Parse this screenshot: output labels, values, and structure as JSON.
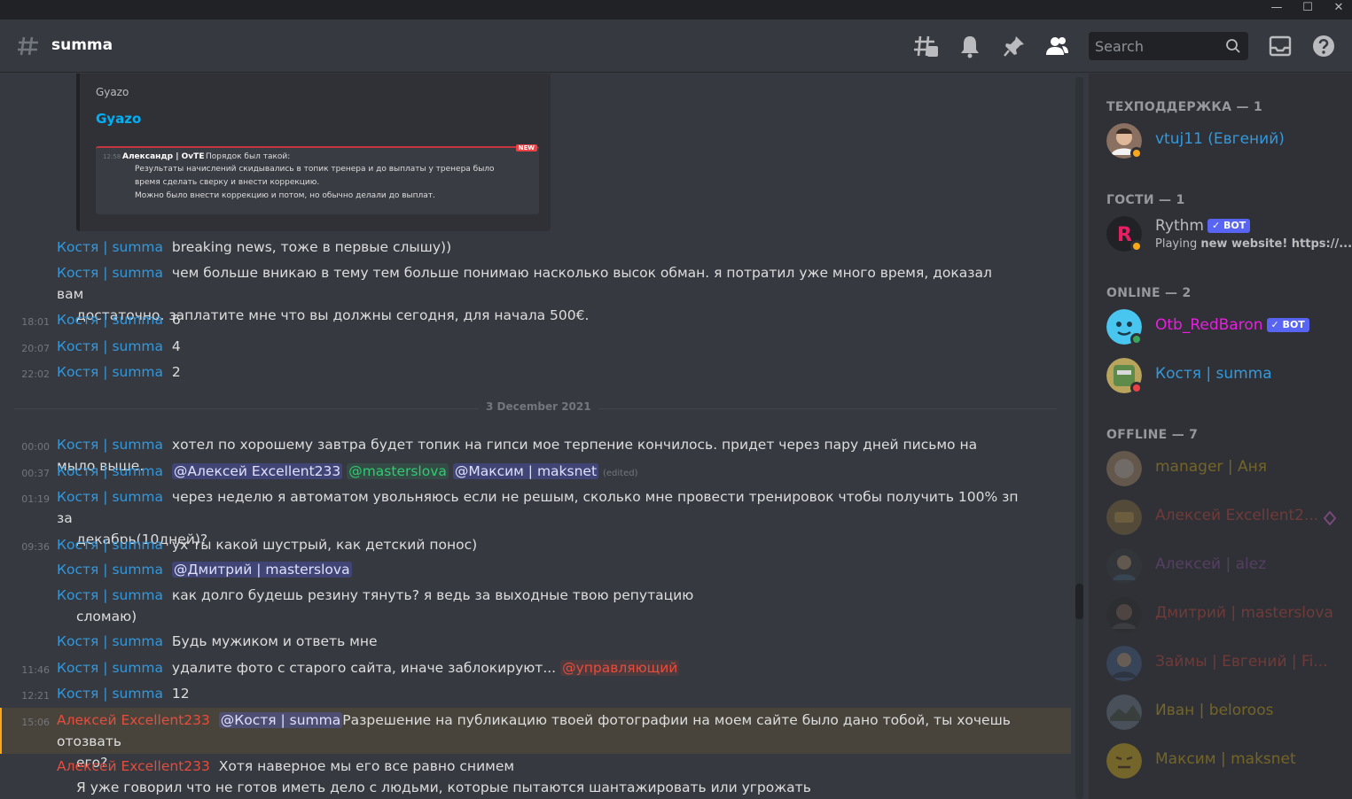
{
  "window": {
    "minimize": "—",
    "maximize": "☐",
    "close": "✕"
  },
  "header": {
    "channel": "summa",
    "search_placeholder": "Search"
  },
  "embed": {
    "provider": "Gyazo",
    "title": "Gyazo",
    "image": {
      "time": "12:58",
      "author": "Александр | OvTE",
      "first": "Порядок был такой:",
      "lines": [
        "Результаты начислений скидывались в топик тренера и до выплаты у тренера было",
        "время сделать сверку и внести коррекцию.",
        "Можно было внести коррекцию и потом, но обычно делали до выплат."
      ],
      "badge": "NEW"
    }
  },
  "messages": [
    {
      "time": "",
      "author": "Костя | summa",
      "text": "breaking news, тоже в первые слышу))"
    },
    {
      "time": "",
      "author": "Костя | summa",
      "text": "чем больше вникаю в тему тем больше понимаю насколько высок обман. я потратил уже много время, доказал вам",
      "cont": "достаточно. заплатите мне что вы должны сегодня, для начала 500€."
    },
    {
      "time": "18:01",
      "author": "Костя | summa",
      "text": "6"
    },
    {
      "time": "20:07",
      "author": "Костя | summa",
      "text": "4"
    },
    {
      "time": "22:02",
      "author": "Костя | summa",
      "text": "2"
    },
    {
      "time": "00:00",
      "author": "Костя | summa",
      "text": "хотел по хорошему завтра будет топик на гипси мое терпение кончилось. придет через пару дней письмо на мыло выше."
    },
    {
      "time": "00:37",
      "author": "Костя | summa",
      "m1": "@Алексей Excellent233",
      "m2": "@masterslova",
      "m3": "@Максим | maksnet",
      "edited": "(edited)"
    },
    {
      "time": "01:19",
      "author": "Костя | summa",
      "text": "через неделю я автоматом увольняюсь если не решым, сколько мне провести тренировок чтобы получить 100% зп за",
      "cont": "декабрь(10дней)?"
    },
    {
      "time": "09:36",
      "author": "Костя | summa",
      "text": "ух ты какой шустрый, как детский понос)"
    },
    {
      "time": "",
      "author": "Костя | summa",
      "m1": "@Дмитрий | masterslova"
    },
    {
      "time": "",
      "author": "Костя | summa",
      "text": "как долго будешь резину тянуть? я ведь за выходные твою репутацию",
      "cont": "сломаю)"
    },
    {
      "time": "",
      "author": "Костя | summa",
      "text": "Будь мужиком и ответь мне"
    },
    {
      "time": "11:46",
      "author": "Костя | summa",
      "text": "удалите фото с старого сайта, иначе заблокируют...",
      "m1": "@управляющий"
    },
    {
      "time": "12:21",
      "author": "Костя | summa",
      "text": "12"
    },
    {
      "time": "15:06",
      "author": "Алексей Excellent233",
      "m1": "@Костя | summa",
      "text": "Разрешение на публикацию твоей фотографии на моем сайте было дано тобой, ты хочешь отозвать",
      "cont": "его?"
    },
    {
      "time": "",
      "author": "Алексей Excellent233",
      "text": "Хотя наверное мы его все равно снимем",
      "cont": "Я уже говорил что не готов иметь дело с людьми, которые пытаются шантажировать или угрожать"
    }
  ],
  "date_divider": "3 December 2021",
  "members": {
    "groups": [
      "ТЕХПОДДЕРЖКА — 1",
      "ГОСТИ — 1",
      "ONLINE — 2",
      "OFFLINE — 7"
    ],
    "list": [
      {
        "name": "vtuj11 (Евгений)",
        "color": "#3498db"
      },
      {
        "name": "Rythm",
        "bot": "✓ BOT",
        "activity_prefix": "Playing ",
        "activity": "new website! https://...",
        "color": "#b9bbbe"
      },
      {
        "name": "Otb_RedBaron",
        "bot": "✓ BOT",
        "color": "#e91ee0"
      },
      {
        "name": "Костя | summa",
        "color": "#3498db"
      },
      {
        "name": "manager | Аня",
        "color": "#f1c40f"
      },
      {
        "name": "Алексей Excellent2...",
        "color": "#e74c3c"
      },
      {
        "name": "Алексей | alez",
        "color": "#9b59b6"
      },
      {
        "name": "Дмитрий | masterslova",
        "color": "#e74c3c"
      },
      {
        "name": "Займы | Евгений | Fi...",
        "color": "#e74c3c"
      },
      {
        "name": "Иван | beloroos",
        "color": "#f1c40f"
      },
      {
        "name": "Максим | maksnet",
        "color": "#f1c40f"
      }
    ]
  }
}
